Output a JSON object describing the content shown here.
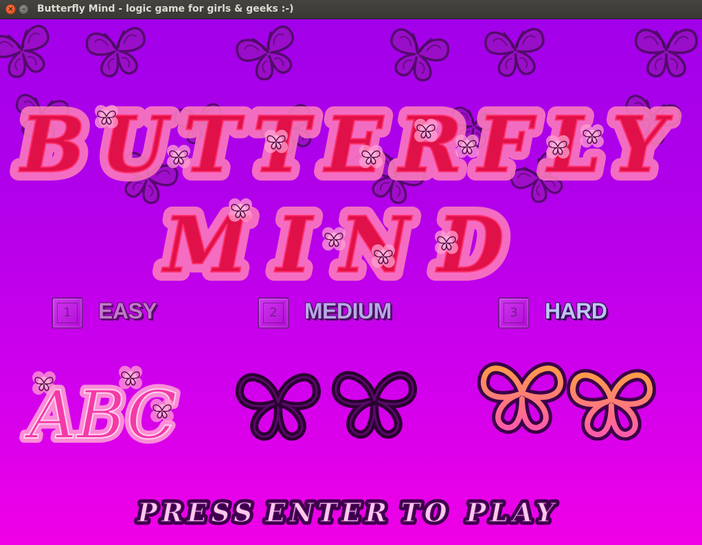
{
  "window": {
    "title": "Butterfly Mind - logic game for girls & geeks :-)",
    "close_glyph": "×",
    "minimize_glyph": "–"
  },
  "game": {
    "title_line1": "BUTTERFLY",
    "title_line2": "MIND",
    "modes": [
      {
        "key": "1",
        "label": "EASY"
      },
      {
        "key": "2",
        "label": "MEDIUM"
      },
      {
        "key": "3",
        "label": "HARD"
      }
    ],
    "preview_easy_text": "ABC",
    "press_words": [
      "PRESS",
      "ENTER",
      "TO",
      "PLAY"
    ]
  },
  "colors": {
    "bg_top": "#a200ea",
    "bg_bottom": "#f000e6",
    "title_fill": "#e0104a",
    "title_glow": "#ff7ab8",
    "butterfly_outline": "#5a0a6a"
  }
}
